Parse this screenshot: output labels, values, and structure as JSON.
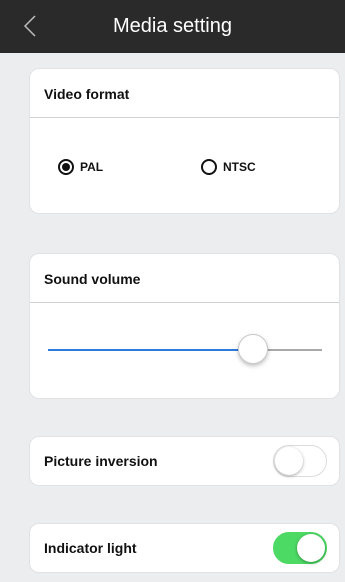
{
  "header": {
    "title": "Media setting",
    "back_icon": "chevron-left-icon"
  },
  "video_format": {
    "title": "Video format",
    "options": [
      {
        "label": "PAL",
        "selected": true
      },
      {
        "label": "NTSC",
        "selected": false
      }
    ]
  },
  "sound_volume": {
    "title": "Sound volume",
    "level_fraction": 0.75
  },
  "picture_inversion": {
    "label": "Picture inversion",
    "enabled": false
  },
  "indicator_light": {
    "label": "Indicator light",
    "enabled": true
  },
  "colors": {
    "header_bg": "#2a2a2a",
    "accent_blue": "#2f7ad8",
    "toggle_on": "#4cd964",
    "background": "#ecedef"
  }
}
